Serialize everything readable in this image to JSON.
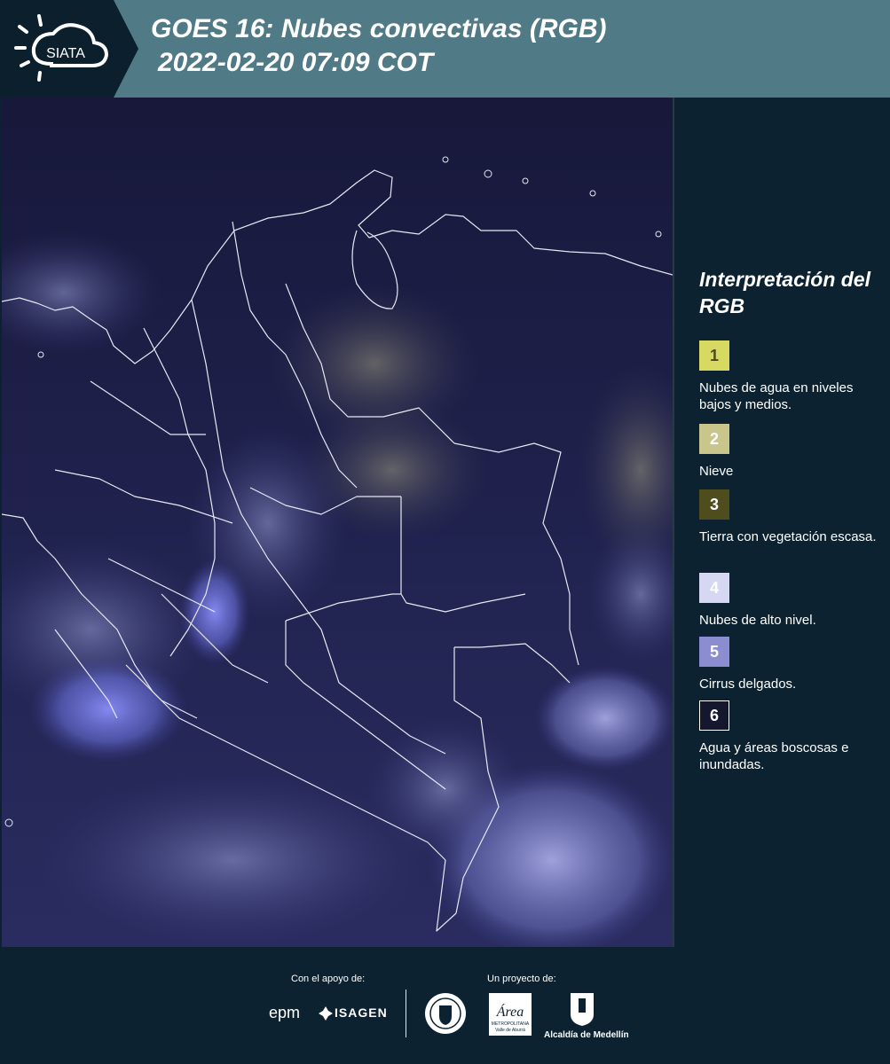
{
  "header": {
    "logo_text": "SIATA",
    "title_line1": "GOES 16: Nubes convectivas (RGB)",
    "title_line2": "2022-02-20 07:09 COT"
  },
  "legend": {
    "title": "Interpretación del RGB",
    "items": [
      {
        "number": "1",
        "label": "Nubes de agua en niveles bajos y medios.",
        "color": "#d8d960",
        "text_color": "#4a4a20"
      },
      {
        "number": "2",
        "label": "Nieve",
        "color": "#c8c68a",
        "text_color": "#ffffff"
      },
      {
        "number": "3",
        "label": "Tierra con vegetación escasa.",
        "color": "#4f4c1e",
        "text_color": "#ffffff"
      },
      {
        "number": "4",
        "label": "Nubes de alto nivel.",
        "color": "#d6d7f3",
        "text_color": "#ffffff"
      },
      {
        "number": "5",
        "label": "Cirrus delgados.",
        "color": "#8c8cd0",
        "text_color": "#ffffff"
      },
      {
        "number": "6",
        "label": "Agua y áreas boscosas e inundadas.",
        "color": "#15172e",
        "text_color": "#ffffff"
      }
    ]
  },
  "footer": {
    "support_label": "Con el apoyo de:",
    "project_label": "Un proyecto de:",
    "epm": "epm",
    "isagen": "ISAGEN",
    "area_logo_text": "Área",
    "area_sub1": "METROPOLITANA",
    "area_sub2": "Valle de Aburrá",
    "alcaldia": "Alcaldía de Medellín"
  },
  "colors": {
    "header_bg": "#4f7a86",
    "page_bg": "#0c2230",
    "map_bg": "#1c1d48",
    "cloud_blue": "#7a80f0"
  }
}
